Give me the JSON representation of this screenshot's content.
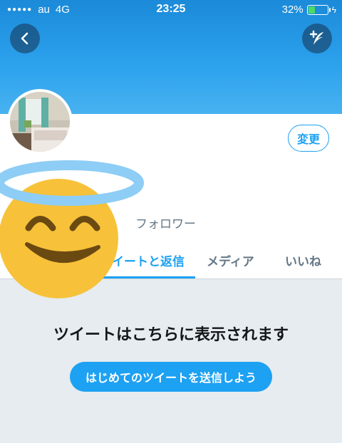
{
  "status_bar": {
    "carrier": "au",
    "network": "4G",
    "time": "23:25",
    "battery": "32%",
    "battery_level": 0.32
  },
  "nav": {
    "back_icon": "chevron-left-icon",
    "compose_icon": "compose-tweet-icon"
  },
  "profile": {
    "edit_label": "変更",
    "followers_label": "フォロワー"
  },
  "tabs": [
    {
      "label": "ツイートと返信",
      "active": true
    },
    {
      "label": "メディア",
      "active": false
    },
    {
      "label": "いいね",
      "active": false
    }
  ],
  "empty_state": {
    "title": "ツイートはこちらに表示されます",
    "cta_label": "はじめてのツイートを送信しよう"
  },
  "colors": {
    "accent": "#1da1f2",
    "emoji": "#f7c23a"
  }
}
